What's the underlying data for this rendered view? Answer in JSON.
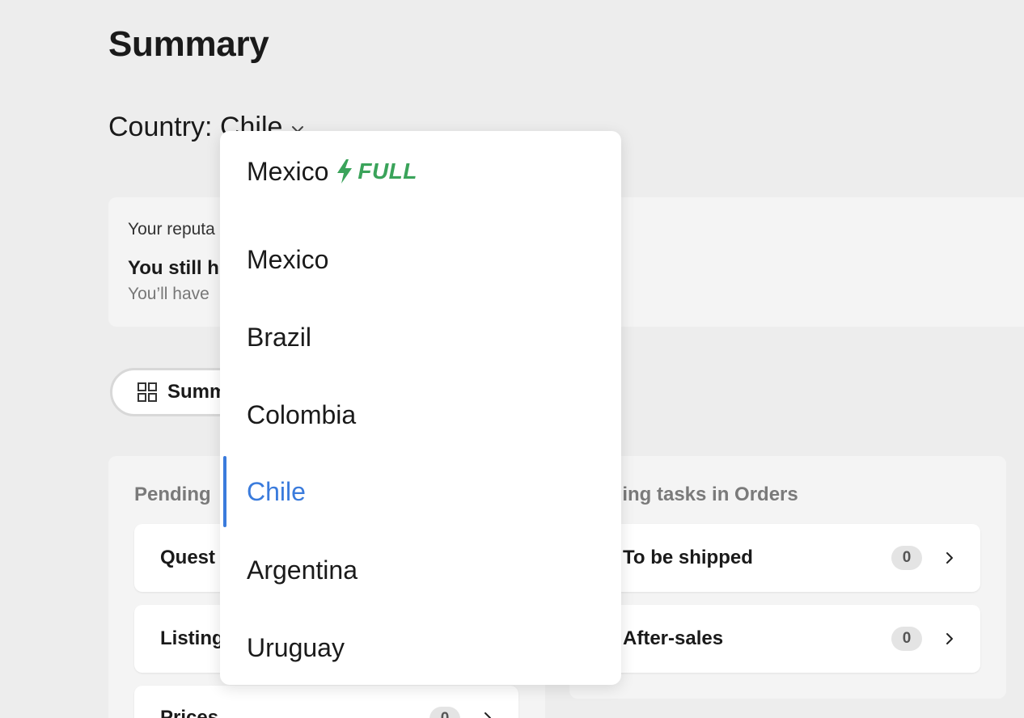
{
  "page": {
    "title": "Summary",
    "country_label": "Country: Chile"
  },
  "reputation": {
    "small_text": "Your reputa",
    "bold_text": "You still h",
    "sub_text": "You’ll have"
  },
  "tab": {
    "label": "Summ"
  },
  "left_panel": {
    "title": "Pending",
    "tasks": [
      {
        "label": "Quest",
        "count": ""
      },
      {
        "label": "Listing",
        "count": ""
      },
      {
        "label": "Prices",
        "count": "0"
      }
    ]
  },
  "right_panel": {
    "title": "nding tasks in Orders",
    "tasks": [
      {
        "label": "To be shipped",
        "count": "0"
      },
      {
        "label": "After-sales",
        "count": "0"
      }
    ]
  },
  "dropdown": {
    "options": [
      {
        "label": "Mexico",
        "badge": "FULL"
      },
      {
        "label": "Mexico"
      },
      {
        "label": "Brazil"
      },
      {
        "label": "Colombia"
      },
      {
        "label": "Chile",
        "selected": true
      },
      {
        "label": "Argentina"
      },
      {
        "label": "Uruguay"
      }
    ]
  },
  "colors": {
    "accent": "#3a7bdc",
    "full_green": "#3aa35a",
    "background": "#ededed"
  },
  "icons": {
    "dropdown_chevron": "chevron-down-icon",
    "tab_icon": "grid-icon",
    "task_arrow": "chevron-right-icon",
    "full_bolt": "lightning-bolt-icon"
  }
}
